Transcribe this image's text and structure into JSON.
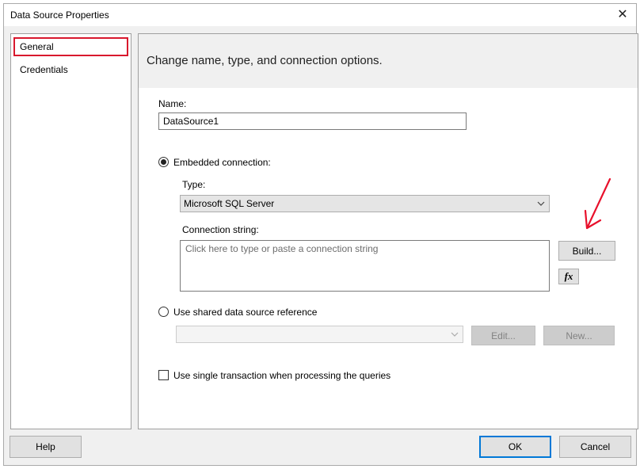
{
  "window": {
    "title": "Data Source Properties"
  },
  "nav": {
    "items": [
      {
        "label": "General",
        "selected": true
      },
      {
        "label": "Credentials",
        "selected": false
      }
    ]
  },
  "header": {
    "text": "Change name, type, and connection options."
  },
  "name": {
    "label": "Name:",
    "value": "DataSource1"
  },
  "embedded": {
    "label": "Embedded connection:",
    "checked": true,
    "type_label": "Type:",
    "type_value": "Microsoft SQL Server",
    "conn_label": "Connection string:",
    "conn_placeholder": "Click here to type or paste a connection string",
    "build_label": "Build...",
    "expr_label": "fx"
  },
  "shared": {
    "label": "Use shared data source reference",
    "checked": false,
    "combo_value": "",
    "edit_label": "Edit...",
    "new_label": "New..."
  },
  "single_transaction": {
    "label": "Use single transaction when processing the queries",
    "checked": false
  },
  "footer": {
    "help_label": "Help",
    "ok_label": "OK",
    "cancel_label": "Cancel"
  },
  "annotation": {
    "arrow_color": "#e8102b"
  }
}
